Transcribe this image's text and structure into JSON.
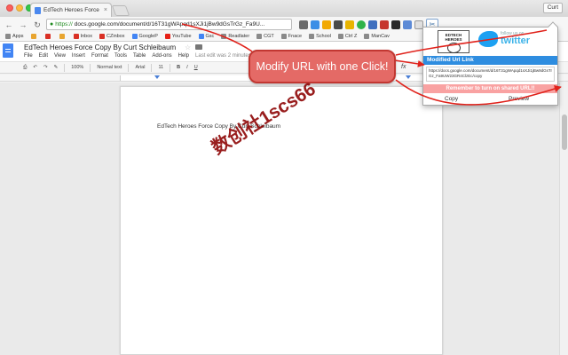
{
  "browser": {
    "tab_title": "EdTech Heroes Force Copy",
    "tab_close": "×",
    "user": "Curt",
    "url_secure": "https://",
    "url_rest": "docs.google.com/document/d/16T31gWApqd1sXJi1jBw9dGsTrGz_Fa9U...",
    "nav": {
      "back": "←",
      "forward": "→",
      "reload": "↻"
    },
    "lock": "🔒",
    "extension_icon": "✂"
  },
  "bookmarks": [
    {
      "label": "Apps",
      "color": "#8a8a8a"
    },
    {
      "label": "",
      "color": "#e8a530"
    },
    {
      "label": "",
      "color": "#d93025"
    },
    {
      "label": "",
      "color": "#e8a530"
    },
    {
      "label": "Inbox",
      "color": "#d93025"
    },
    {
      "label": "CZinbox",
      "color": "#d93025"
    },
    {
      "label": "GoogleP",
      "color": "#4285f4"
    },
    {
      "label": "YouTube",
      "color": "#e62117"
    },
    {
      "label": "Gsc",
      "color": "#4285f4"
    },
    {
      "label": "Readlater",
      "color": "#8a8a8a"
    },
    {
      "label": "CGT",
      "color": "#8a8a8a"
    },
    {
      "label": "Fnace",
      "color": "#8a8a8a"
    },
    {
      "label": "School",
      "color": "#8a8a8a"
    },
    {
      "label": "Ctrl Z",
      "color": "#8a8a8a"
    },
    {
      "label": "ManCav",
      "color": "#8a8a8a"
    }
  ],
  "docs": {
    "title": "EdTech Heroes Force Copy By Curt Schleibaum",
    "menu": [
      "File",
      "Edit",
      "View",
      "Insert",
      "Format",
      "Tools",
      "Table",
      "Add-ons",
      "Help"
    ],
    "last_edit": "Last edit was 2 minutes ago",
    "toolbar": {
      "zoom": "100%",
      "style": "Normal text",
      "font": "Arial",
      "size": "11",
      "bold": "B",
      "italic": "I",
      "underline": "U",
      "fx": "fx"
    },
    "body_text": "EdTech Heroes Force Copy By Curt Schleibaum"
  },
  "popup": {
    "logo_text": "EDTECH HEROES",
    "follow_label": "follow us on",
    "twitter_word": "twitter",
    "header": "Modified Url Link",
    "modified_url": "https://docs.google.com/document/d/16T31gWApqd1sXJi1jBw9dGsTrGz_Fa9UW23GR4ClzEc/copy",
    "warning": "Remember to turn on shared URL!!",
    "copy_label": "Copy",
    "preview_label": "Preview"
  },
  "annotation": {
    "callout": "Modify URL with one Click!",
    "watermark": "数创社1scs66",
    "arrow_color": "#e0221b"
  }
}
